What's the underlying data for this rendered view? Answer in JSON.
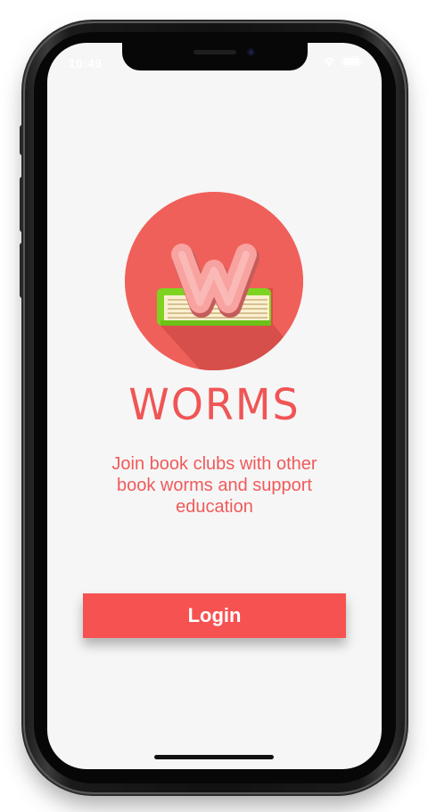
{
  "status_bar": {
    "time": "10:49",
    "icons": [
      "wifi-icon",
      "battery-icon"
    ]
  },
  "app": {
    "name": "WORMS",
    "logo_letter": "W",
    "tagline": "Join book clubs with other book worms and support education"
  },
  "login_button": {
    "label": "Login"
  },
  "colors": {
    "accent": "#F75252",
    "background": "#F6F6F6",
    "logo_circle": "#F0605A",
    "book_cover": "#7ED321",
    "worm": "#F8A3A0"
  }
}
